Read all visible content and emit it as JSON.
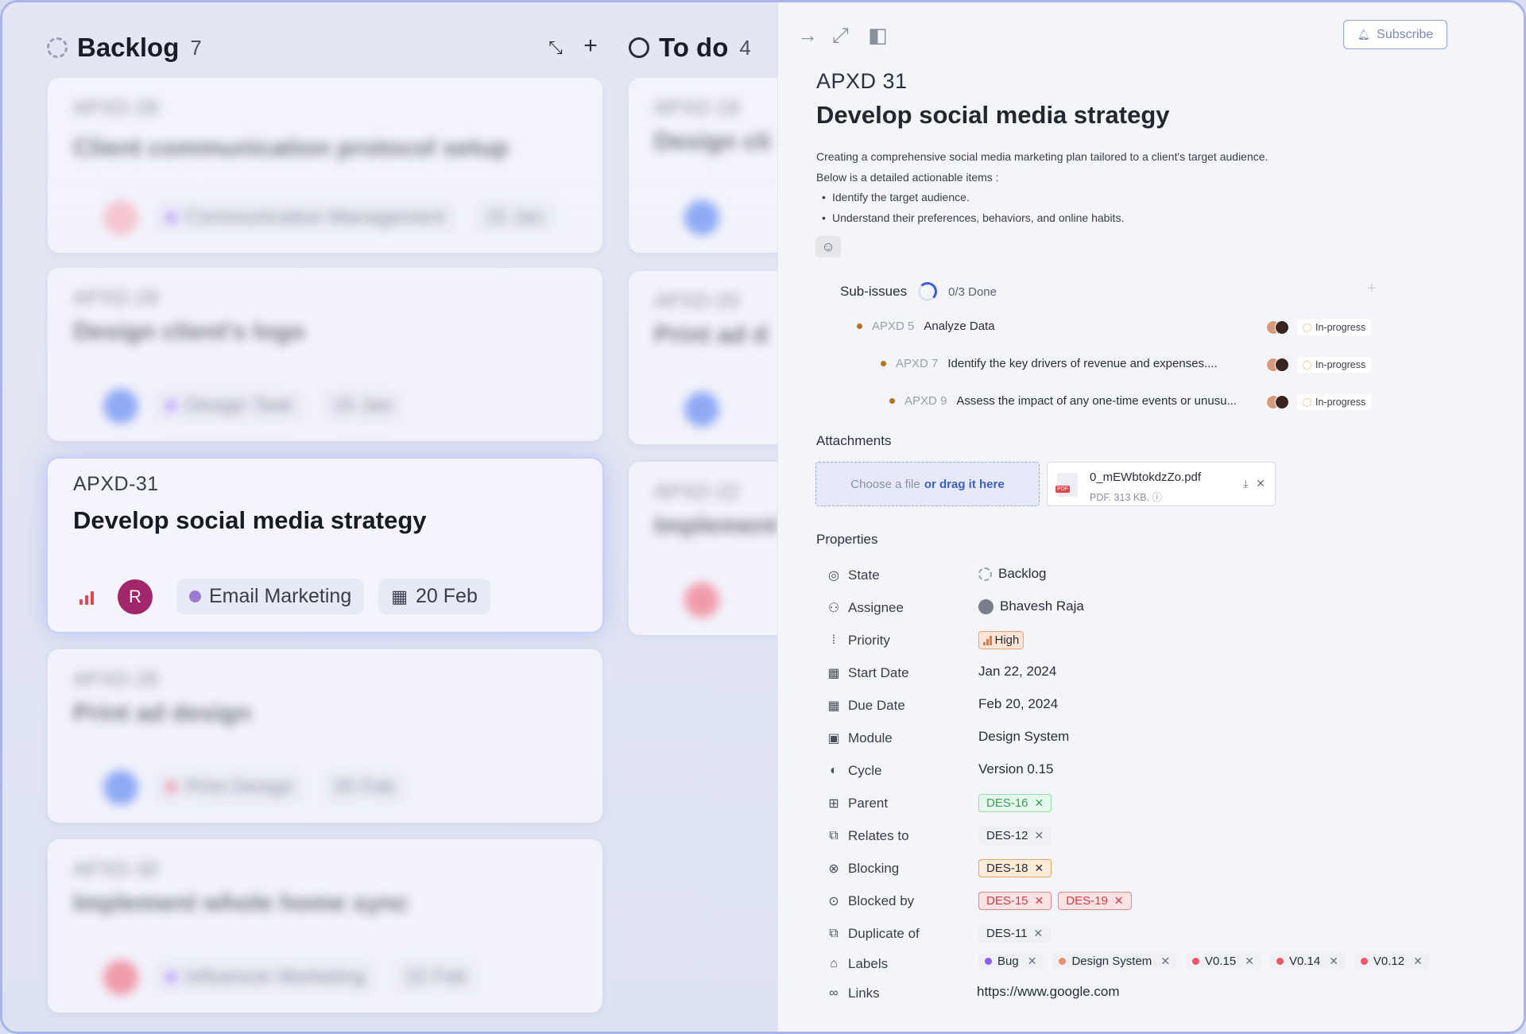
{
  "board": {
    "columns": [
      {
        "title": "Backlog",
        "count": "7"
      },
      {
        "title": "To do",
        "count": "4"
      }
    ],
    "selected_card": {
      "id": "APXD-31",
      "title": "Develop social media strategy",
      "assignee_initial": "R",
      "module": "Email Marketing",
      "module_color": "#9b7ad6",
      "date": "20 Feb"
    },
    "blurred_cards": [
      {
        "id": "APXD-28",
        "title": "Client communication protocol setup",
        "module": "Communication Management",
        "date": "15 Jan"
      },
      {
        "id": "APXD-29",
        "title": "Design client's logo",
        "module": "Design Task",
        "date": "15 Jan"
      },
      {
        "id": "APXD-26",
        "title": "Print ad design",
        "module": "Print Design",
        "date": "20 Feb"
      },
      {
        "id": "APXD-30",
        "title": "Implement whole home sync",
        "module": "Influencer Marketing",
        "date": "22 Feb"
      }
    ],
    "todo_blurred_cards": [
      {
        "id": "APXD-18",
        "title": "Design cli"
      },
      {
        "id": "APXD-20",
        "title": "Print ad d"
      },
      {
        "id": "APXD-22",
        "title": "Implement"
      }
    ]
  },
  "panel": {
    "subscribe_label": "Subscribe",
    "issue_id": "APXD 31",
    "title": "Develop social media strategy",
    "description_lines": [
      "Creating a comprehensive social media marketing plan tailored to a client's target audience.",
      "Below is a detailed actionable items :"
    ],
    "bullets": [
      "Identify the target audience.",
      "Understand their preferences, behaviors, and online habits."
    ],
    "sub_issues": {
      "label": "Sub-issues",
      "progress": "0/3 Done",
      "items": [
        {
          "id": "APXD 5",
          "title": "Analyze Data",
          "status": "In-progress"
        },
        {
          "id": "APXD 7",
          "title": "Identify the key drivers of revenue and expenses....",
          "status": "In-progress"
        },
        {
          "id": "APXD 9",
          "title": "Assess the impact of any one-time events or unusu...",
          "status": "In-progress"
        }
      ]
    },
    "attachments": {
      "label": "Attachments",
      "drop_text": "Choose a file",
      "drop_link": "or drag it here",
      "file_name": "0_mEWbtokdzZo.pdf",
      "file_meta": "PDF. 313 KB.",
      "pdf_badge": "PDF"
    },
    "properties": {
      "label": "Properties",
      "state": {
        "label": "State",
        "value": "Backlog"
      },
      "assignee": {
        "label": "Assignee",
        "value": "Bhavesh Raja"
      },
      "priority": {
        "label": "Priority",
        "value": "High"
      },
      "start_date": {
        "label": "Start Date",
        "value": "Jan 22, 2024"
      },
      "due_date": {
        "label": "Due Date",
        "value": "Feb 20, 2024"
      },
      "module": {
        "label": "Module",
        "value": "Design System"
      },
      "cycle": {
        "label": "Cycle",
        "value": "Version 0.15"
      },
      "parent": {
        "label": "Parent",
        "value": "DES-16"
      },
      "relates_to": {
        "label": "Relates to",
        "value": "DES-12"
      },
      "blocking": {
        "label": "Blocking",
        "value": "DES-18"
      },
      "blocked_by": {
        "label": "Blocked by",
        "values": [
          "DES-15",
          "DES-19"
        ]
      },
      "duplicate_of": {
        "label": "Duplicate of",
        "value": "DES-11"
      },
      "labels": {
        "label": "Labels",
        "values": [
          {
            "name": "Bug",
            "color": "#8b5cf6"
          },
          {
            "name": "Design System",
            "color": "#f08a6a"
          },
          {
            "name": "V0.15",
            "color": "#f0556a"
          },
          {
            "name": "V0.14",
            "color": "#f0556a"
          },
          {
            "name": "V0.12",
            "color": "#f0556a"
          }
        ]
      },
      "links": {
        "label": "Links",
        "value": "https://www.google.com"
      }
    }
  },
  "colors": {
    "accent": "#3b5bdb",
    "priority_high": "#e0484e",
    "selected_glow": "#c7d0fa"
  }
}
